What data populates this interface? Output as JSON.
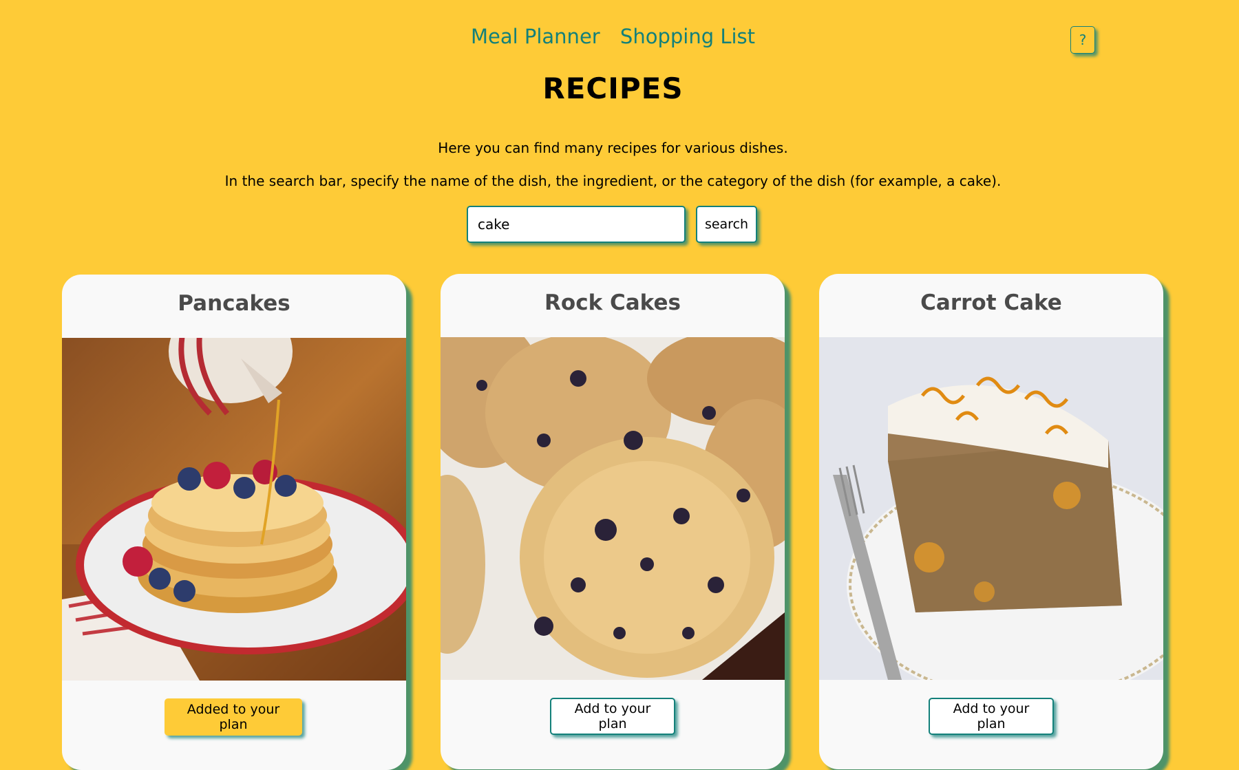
{
  "nav": {
    "meal_planner": "Meal Planner",
    "shopping_list": "Shopping List",
    "help": "?"
  },
  "page_title": "RECIPES",
  "intro": {
    "line1": "Here you can find many recipes for various dishes.",
    "line2": "In the search bar, specify the name of the dish, the ingredient, or the category of the dish (for example, a cake)."
  },
  "search": {
    "value": "cake",
    "button_label": "search"
  },
  "recipes": [
    {
      "title": "Pancakes",
      "image": "pancakes-photo",
      "button_label": "Added to your plan",
      "added": true
    },
    {
      "title": "Rock Cakes",
      "image": "rock-cakes-photo",
      "button_label": "Add to your plan",
      "added": false
    },
    {
      "title": "Carrot Cake",
      "image": "carrot-cake-photo",
      "button_label": "Add to your plan",
      "added": false
    }
  ],
  "colors": {
    "background": "#FECB37",
    "accent": "#13807A",
    "card": "#F9F9F9",
    "title_text": "#4A4A4A"
  }
}
